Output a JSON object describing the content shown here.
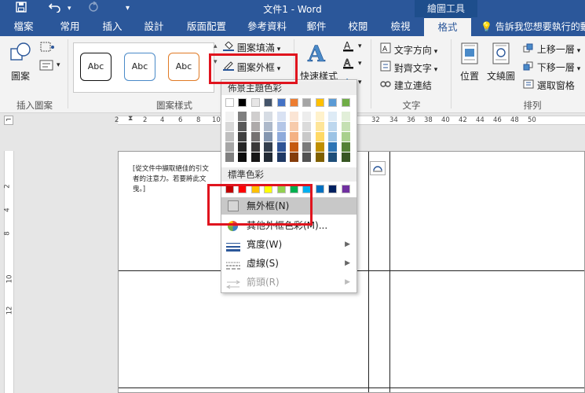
{
  "titlebar": {
    "title": "文件1 - Word",
    "context_tools": "繪圖工具"
  },
  "tabs": [
    "檔案",
    "常用",
    "插入",
    "設計",
    "版面配置",
    "參考資料",
    "郵件",
    "校閱",
    "檢視",
    "格式"
  ],
  "active_tab": "格式",
  "tell_me": "告訴我您想要執行的動",
  "ribbon": {
    "insert_shapes": {
      "shape_label": "圖案",
      "group_label": "插入圖案"
    },
    "shape_styles": {
      "samples": [
        "Abc",
        "Abc",
        "Abc"
      ],
      "fill_label": "圖案填滿",
      "outline_label": "圖案外框",
      "group_label": "圖案樣式"
    },
    "wordart": {
      "quick_styles_label": "快速樣式"
    },
    "text": {
      "direction_label": "文字方向",
      "align_label": "對齊文字",
      "link_label": "建立連結",
      "group_label": "文字"
    },
    "arrange": {
      "position_label": "位置",
      "wrap_label": "文繞圖",
      "forward_label": "上移一層",
      "backward_label": "下移一層",
      "selection_pane_label": "選取窗格",
      "group_label": "排列"
    }
  },
  "ruler": {
    "h_numbers": [
      "2",
      "2",
      "4",
      "6",
      "8",
      "10",
      "32",
      "34",
      "36",
      "38",
      "40",
      "42",
      "44",
      "46",
      "48",
      "50"
    ],
    "v_numbers": [
      "2",
      "4",
      "8",
      "10",
      "12"
    ]
  },
  "document": {
    "lines": [
      "[從文件中擷取絕佳的引文",
      "者的注意力。若要將此文",
      "曳。]"
    ]
  },
  "dropdown": {
    "theme_colors_header": "佈景主題色彩",
    "standard_colors_header": "標準色彩",
    "no_outline_label": "無外框(N)",
    "more_colors_label": "其他外框色彩(M)...",
    "weight_label": "寬度(W)",
    "dashes_label": "虛線(S)",
    "arrows_label": "箭頭(R)"
  },
  "colors": {
    "accent": "#2b579a",
    "highlight": "#e0141e",
    "theme_top": [
      "#ffffff",
      "#000000",
      "#e7e6e6",
      "#44546a",
      "#4472c4",
      "#ed7d31",
      "#a5a5a5",
      "#ffc000",
      "#5b9bd5",
      "#70ad47"
    ],
    "theme_columns": [
      [
        "#f2f2f2",
        "#d9d9d9",
        "#bfbfbf",
        "#a6a6a6",
        "#808080"
      ],
      [
        "#7f7f7f",
        "#595959",
        "#404040",
        "#262626",
        "#0d0d0d"
      ],
      [
        "#d0cece",
        "#aeaaaa",
        "#757171",
        "#3a3838",
        "#171616"
      ],
      [
        "#d6dce4",
        "#adb9ca",
        "#8496b0",
        "#333f4f",
        "#222a35"
      ],
      [
        "#d9e2f3",
        "#b4c6e7",
        "#8eaadb",
        "#2f5496",
        "#1f3864"
      ],
      [
        "#fbe5d5",
        "#f7cbac",
        "#f4b183",
        "#c55a11",
        "#843c0b"
      ],
      [
        "#ededed",
        "#dbdbdb",
        "#c9c9c9",
        "#7b7b7b",
        "#525252"
      ],
      [
        "#fff2cc",
        "#fee599",
        "#ffd965",
        "#bf8f00",
        "#7f6000"
      ],
      [
        "#deebf6",
        "#bdd7ee",
        "#9cc3e5",
        "#2e75b5",
        "#1e4e79"
      ],
      [
        "#e2efd9",
        "#c5e0b3",
        "#a8d08d",
        "#538135",
        "#375623"
      ]
    ],
    "standard": [
      "#c00000",
      "#ff0000",
      "#ffc000",
      "#ffff00",
      "#92d050",
      "#00b050",
      "#00b0f0",
      "#0070c0",
      "#002060",
      "#7030a0"
    ]
  }
}
